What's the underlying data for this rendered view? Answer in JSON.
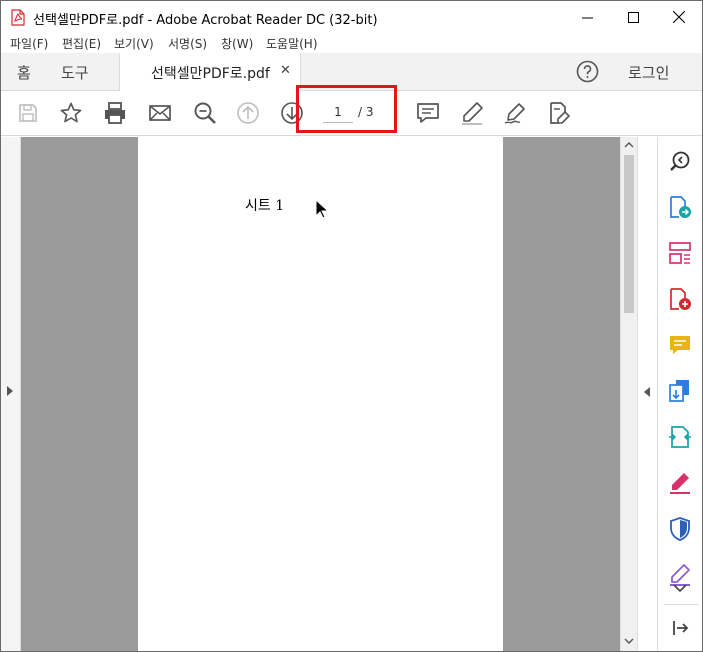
{
  "window": {
    "title": "선택셀만PDF로.pdf - Adobe Acrobat Reader DC (32-bit)",
    "controls": [
      "minimize-icon",
      "maximize-icon",
      "close-icon"
    ]
  },
  "menu": [
    "파일(F)",
    "편집(E)",
    "보기(V)",
    "서명(S)",
    "창(W)",
    "도움말(H)"
  ],
  "tabs": {
    "home": "홈",
    "tools": "도구",
    "document": "선택셀만PDF로.pdf",
    "close_symbol": "✕",
    "login": "로그인"
  },
  "toolbar": {
    "icons": [
      "save-icon",
      "bookmark-star-icon",
      "print-icon",
      "email-icon",
      "zoom-search-icon",
      "prev-page-icon",
      "next-page-icon",
      "comment-icon",
      "highlight-pen-icon",
      "sign-pen-icon",
      "fill-sign-icon"
    ],
    "page_current": "1",
    "page_total": "/ 3"
  },
  "document": {
    "page_text": "시트 1"
  },
  "tools_pane": {
    "icons": [
      "search-zoom-icon",
      "export-pdf-icon",
      "organize-pages-icon",
      "create-pdf-icon",
      "comment-icon",
      "combine-files-icon",
      "compress-pdf-icon",
      "fill-sign-icon",
      "protect-shield-icon",
      "edit-pen-icon",
      "expand-more-icon",
      "collapse-pane-icon"
    ]
  },
  "colors": {
    "highlight_box": "#e8141b",
    "acrobat_red": "#d7282f",
    "viewport_gray": "#9b9b9b",
    "tool_blue": "#2d7de0",
    "tool_pink": "#d6336c",
    "tool_yellow": "#e8b512",
    "tool_teal": "#18a4a6",
    "tool_purple": "#8e5fd6"
  }
}
